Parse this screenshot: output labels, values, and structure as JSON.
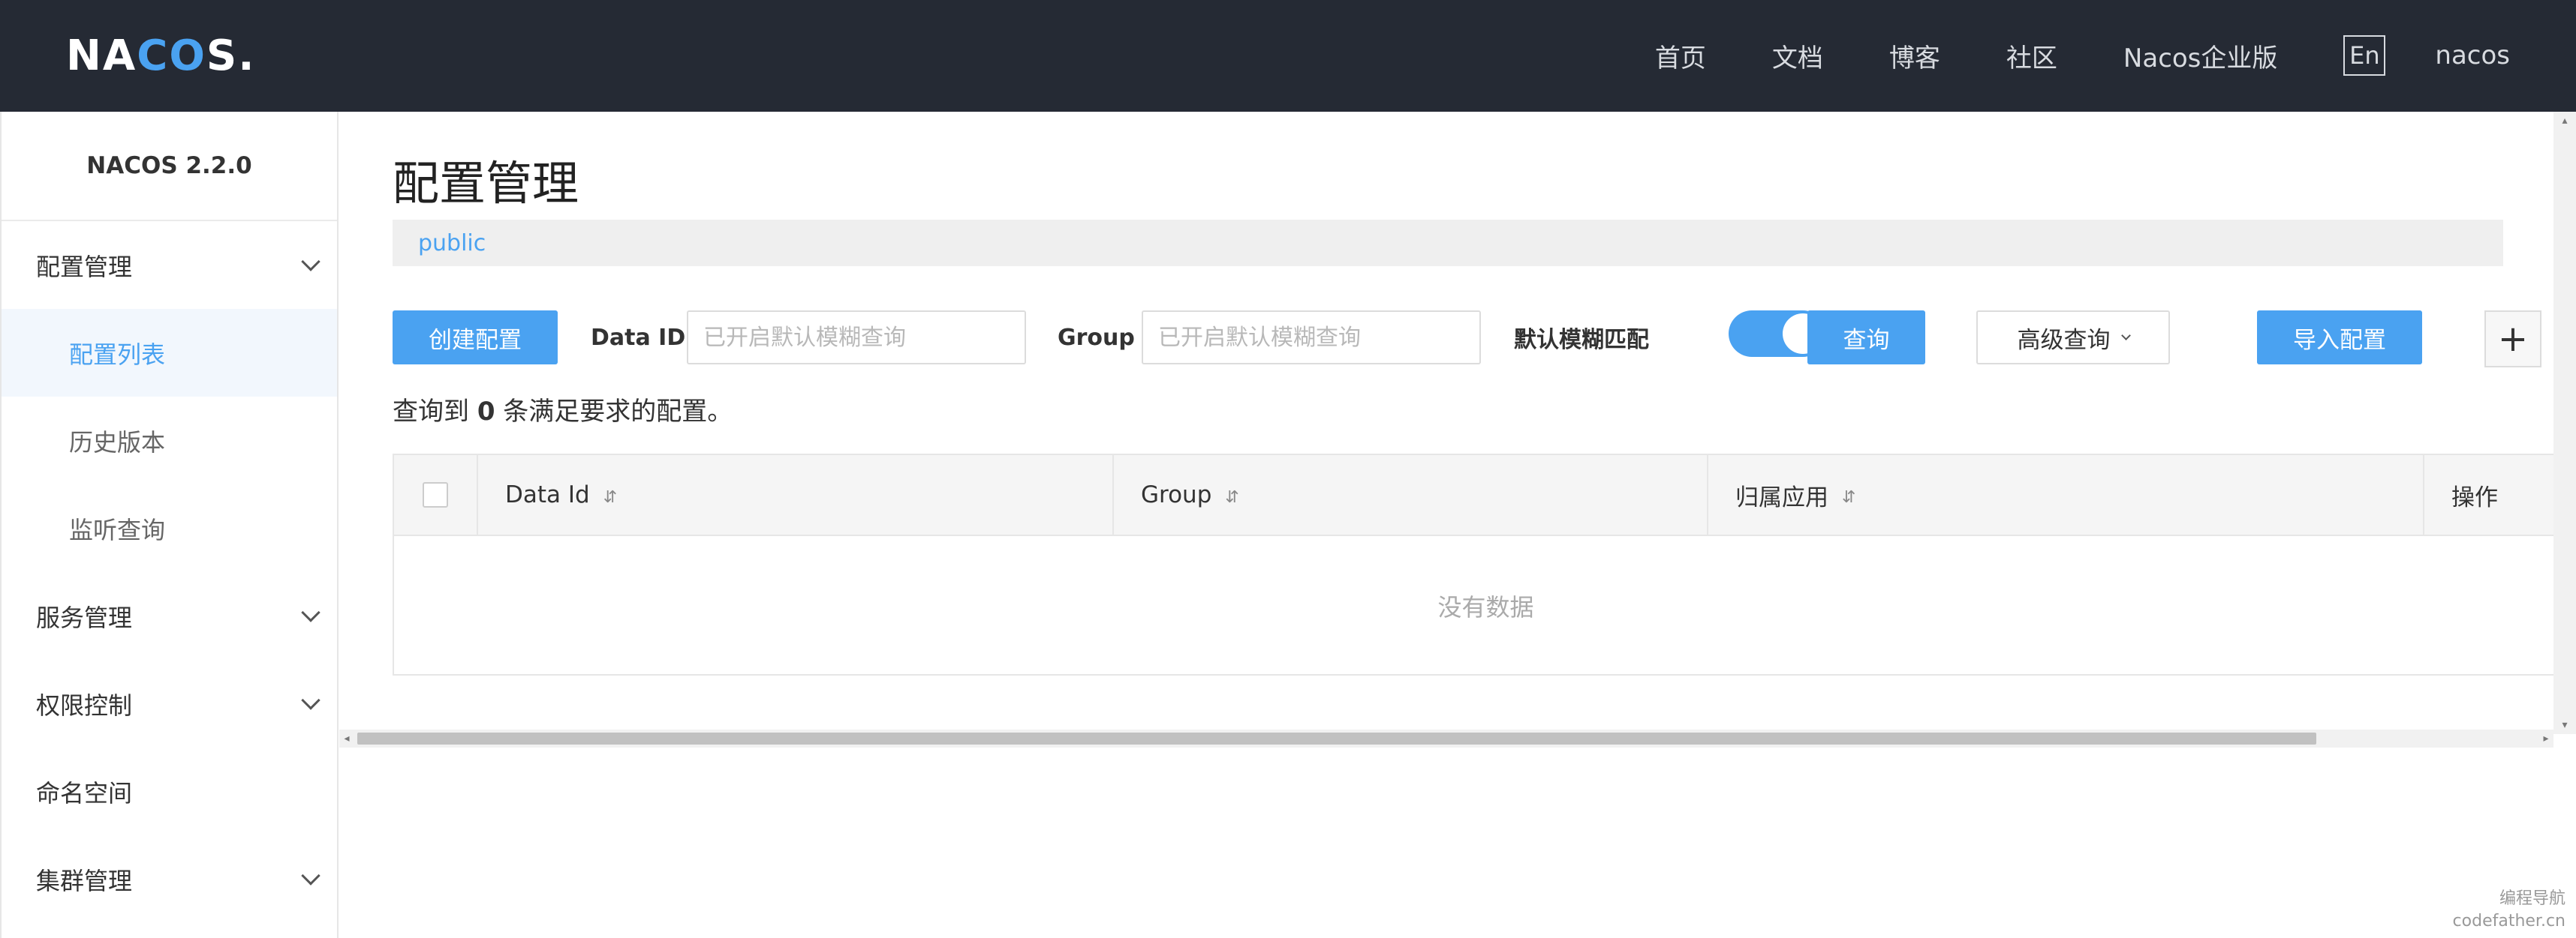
{
  "header": {
    "logo_prefix": "NA",
    "logo_highlight": "CO",
    "logo_suffix": "S",
    "logo_dot": ".",
    "nav": [
      "首页",
      "文档",
      "博客",
      "社区",
      "Nacos企业版"
    ],
    "lang_button": "En",
    "user": "nacos"
  },
  "sidebar": {
    "version": "NACOS 2.2.0",
    "items": [
      {
        "label": "配置管理",
        "expandable": true
      },
      {
        "label": "配置列表",
        "active": true
      },
      {
        "label": "历史版本"
      },
      {
        "label": "监听查询"
      },
      {
        "label": "服务管理",
        "expandable": true
      },
      {
        "label": "权限控制",
        "expandable": true
      },
      {
        "label": "命名空间"
      },
      {
        "label": "集群管理",
        "expandable": true
      }
    ]
  },
  "main": {
    "title": "配置管理",
    "namespace": "public",
    "filters": {
      "create_button": "创建配置",
      "data_id_label": "Data ID",
      "data_id_placeholder": "已开启默认模糊查询",
      "group_label": "Group",
      "group_placeholder": "已开启默认模糊查询",
      "fuzzy_label": "默认模糊匹配",
      "fuzzy_enabled": true,
      "query_button": "查询",
      "advanced_button": "高级查询",
      "import_button": "导入配置",
      "plus_button": "+"
    },
    "result": {
      "prefix": "查询到",
      "count": "0",
      "suffix": "条满足要求的配置。"
    },
    "table": {
      "columns": [
        "Data Id",
        "Group",
        "归属应用",
        "操作"
      ],
      "sort_glyph": "⇵",
      "empty_text": "没有数据"
    }
  },
  "watermark": {
    "line1": "编程导航",
    "line2": "codefather.cn"
  },
  "colors": {
    "topbar": "#252a34",
    "accent": "#4aa2f1",
    "active_bg": "#f2f7fd"
  }
}
